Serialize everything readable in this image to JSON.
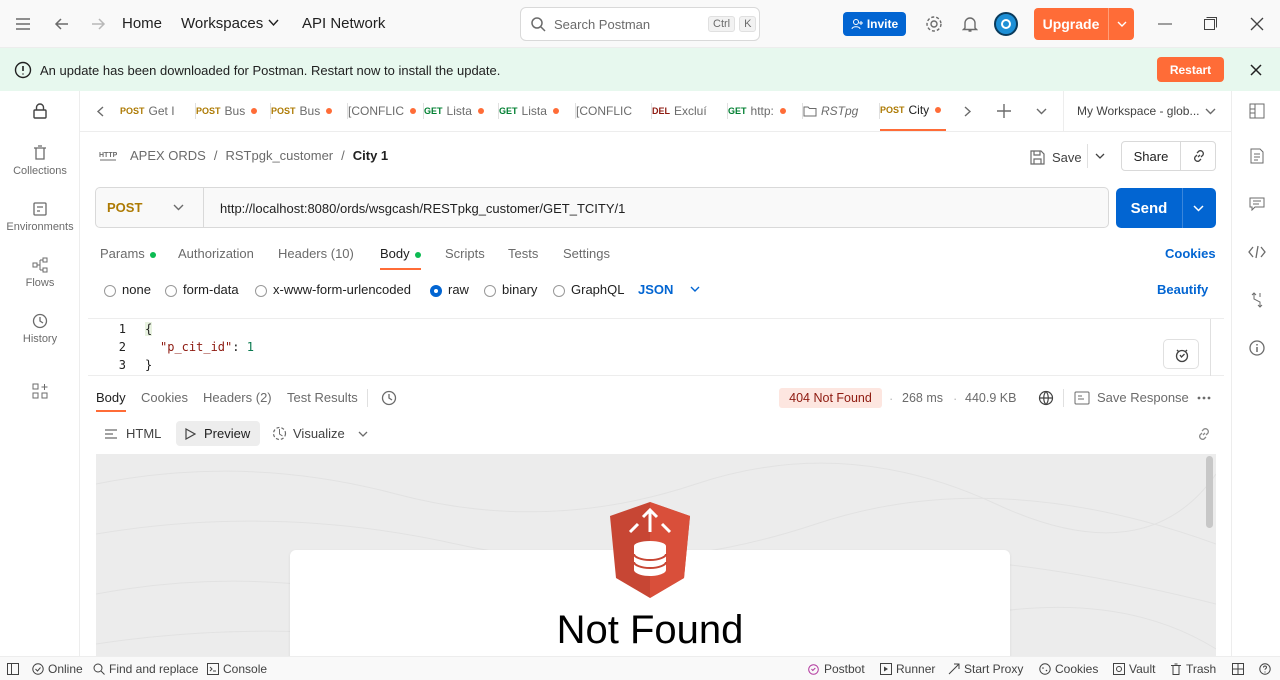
{
  "nav": {
    "home": "Home",
    "workspaces": "Workspaces",
    "api_network": "API Network"
  },
  "search": {
    "placeholder": "Search Postman",
    "kbd1": "Ctrl",
    "kbd2": "K"
  },
  "header": {
    "invite": "Invite",
    "upgrade": "Upgrade"
  },
  "banner": {
    "message": "An update has been downloaded for Postman. Restart now to install the update.",
    "restart": "Restart"
  },
  "sidebar": {
    "items": [
      {
        "label": "Collections",
        "icon": "trash-can-icon"
      },
      {
        "label": "Environments",
        "icon": "environment-icon"
      },
      {
        "label": "Flows",
        "icon": "flows-icon"
      },
      {
        "label": "History",
        "icon": "history-icon"
      }
    ]
  },
  "tabs": [
    {
      "method": "POST",
      "name": "Get I",
      "dot": false,
      "color": "#ad7a03"
    },
    {
      "method": "POST",
      "name": "Bus",
      "dot": true,
      "color": "#ad7a03"
    },
    {
      "method": "POST",
      "name": "Bus",
      "dot": true,
      "color": "#ad7a03"
    },
    {
      "method": "",
      "name": "[CONFLIC",
      "dot": true,
      "color": "#6b6b6b"
    },
    {
      "method": "GET",
      "name": "Lista",
      "dot": true,
      "color": "#007f31"
    },
    {
      "method": "GET",
      "name": "Lista",
      "dot": true,
      "color": "#007f31"
    },
    {
      "method": "",
      "name": "[CONFLIC",
      "dot": false,
      "color": "#6b6b6b"
    },
    {
      "method": "DEL",
      "name": "Excluí",
      "dot": false,
      "color": "#8e1a10"
    },
    {
      "method": "GET",
      "name": "http:",
      "dot": true,
      "color": "#007f31"
    },
    {
      "method": "",
      "name": "RSTpg",
      "dot": false,
      "color": "#6b6b6b"
    },
    {
      "method": "POST",
      "name": "City",
      "dot": true,
      "color": "#ad7a03"
    }
  ],
  "workspace": "My Workspace - glob...",
  "breadcrumb": {
    "root": "APEX ORDS",
    "folder": "RSTpgk_customer",
    "current": "City 1",
    "sep": "/"
  },
  "actions": {
    "save": "Save",
    "share": "Share"
  },
  "request": {
    "method": "POST",
    "url": "http://localhost:8080/ords/wsgcash/RESTpkg_customer/GET_TCITY/1",
    "send": "Send"
  },
  "req_tabs": {
    "params": "Params",
    "authorization": "Authorization",
    "headers": "Headers (10)",
    "body": "Body",
    "scripts": "Scripts",
    "tests": "Tests",
    "settings": "Settings",
    "cookies": "Cookies"
  },
  "body_modes": {
    "none": "none",
    "form_data": "form-data",
    "urlencoded": "x-www-form-urlencoded",
    "raw": "raw",
    "binary": "binary",
    "graphql": "GraphQL",
    "lang": "JSON",
    "beautify": "Beautify"
  },
  "editor": {
    "lines": [
      "1",
      "2",
      "3"
    ],
    "line1": "{",
    "key": "\"p_cit_id\"",
    "colon": ": ",
    "val": "1",
    "line3": "}"
  },
  "response": {
    "tabs": {
      "body": "Body",
      "cookies": "Cookies",
      "headers": "Headers (2)",
      "tests": "Test Results"
    },
    "status": "404 Not Found",
    "time": "268 ms",
    "size": "440.9 KB",
    "save": "Save Response",
    "views": {
      "html": "HTML",
      "preview": "Preview",
      "visualize": "Visualize"
    },
    "preview_title": "Not Found"
  },
  "statusbar": {
    "online": "Online",
    "find": "Find and replace",
    "console": "Console",
    "postbot": "Postbot",
    "runner": "Runner",
    "proxy": "Start Proxy",
    "cookies": "Cookies",
    "vault": "Vault",
    "trash": "Trash"
  },
  "colors": {
    "accent": "#ff6c37",
    "primary": "#0265d2",
    "post": "#ad7a03",
    "get": "#007f31"
  }
}
